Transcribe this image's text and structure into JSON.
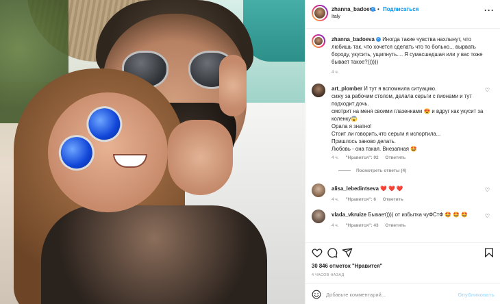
{
  "post": {
    "username": "zhanna_badoeva",
    "follow_label": "Подписаться",
    "dot": "•",
    "location": "Italy",
    "more": "···",
    "caption": "Иногда такие чувства нахлынут, что любишь так, что хочется сделать что то больно... вырвать бороду, укусить, ущипнуть.... Я сумасшедшая или у вас тоже бывает такое?))))))",
    "caption_time": "4 ч."
  },
  "comments": [
    {
      "username": "art_plomber",
      "text": "И тут я вспомнила ситуацию.\nсижу за рабочим столом, делала серьги с пионами и тут подходит дочь.\nсмотрит на меня своими глазенками 😍 и вдруг как укусит за коленку😱\nОрала я знатно!\nСтоит ли говорить,что серьги я испортила...\nПришлось заново делать.\nЛюбовь - она такая. Внезапная 🤩",
      "time": "4 ч.",
      "likes": "\"Нравится\": 92",
      "reply": "Ответить",
      "replies": "Посмотреть ответы (4)"
    },
    {
      "username": "alisa_lebedintseva",
      "text": "❤️ ❤️ ❤️",
      "time": "4 ч.",
      "likes": "\"Нравится\": 6",
      "reply": "Ответить"
    },
    {
      "username": "vlada_vkruize",
      "text": "Бывает)))) от избытка чуФСтФ 🤩 🤩 🤩",
      "time": "4 ч.",
      "likes": "\"Нравится\": 43",
      "reply": "Ответить"
    }
  ],
  "likes_summary": {
    "count": "30 846 отметок",
    "label": "\"Нравится\""
  },
  "time_ago": "4 ЧАСОВ НАЗАД",
  "add_comment": {
    "placeholder": "Добавьте комментарий...",
    "publish": "Опубликовать"
  },
  "icons": {
    "verified": "verified-badge",
    "heart": "heart-icon",
    "comment": "comment-icon",
    "share": "share-icon",
    "save": "bookmark-icon",
    "emoji": "emoji-icon"
  },
  "colors": {
    "accent": "#0095f6",
    "verified": "#3897f0",
    "muted": "#8e8e8e",
    "publish_disabled": "#b2dffc"
  }
}
